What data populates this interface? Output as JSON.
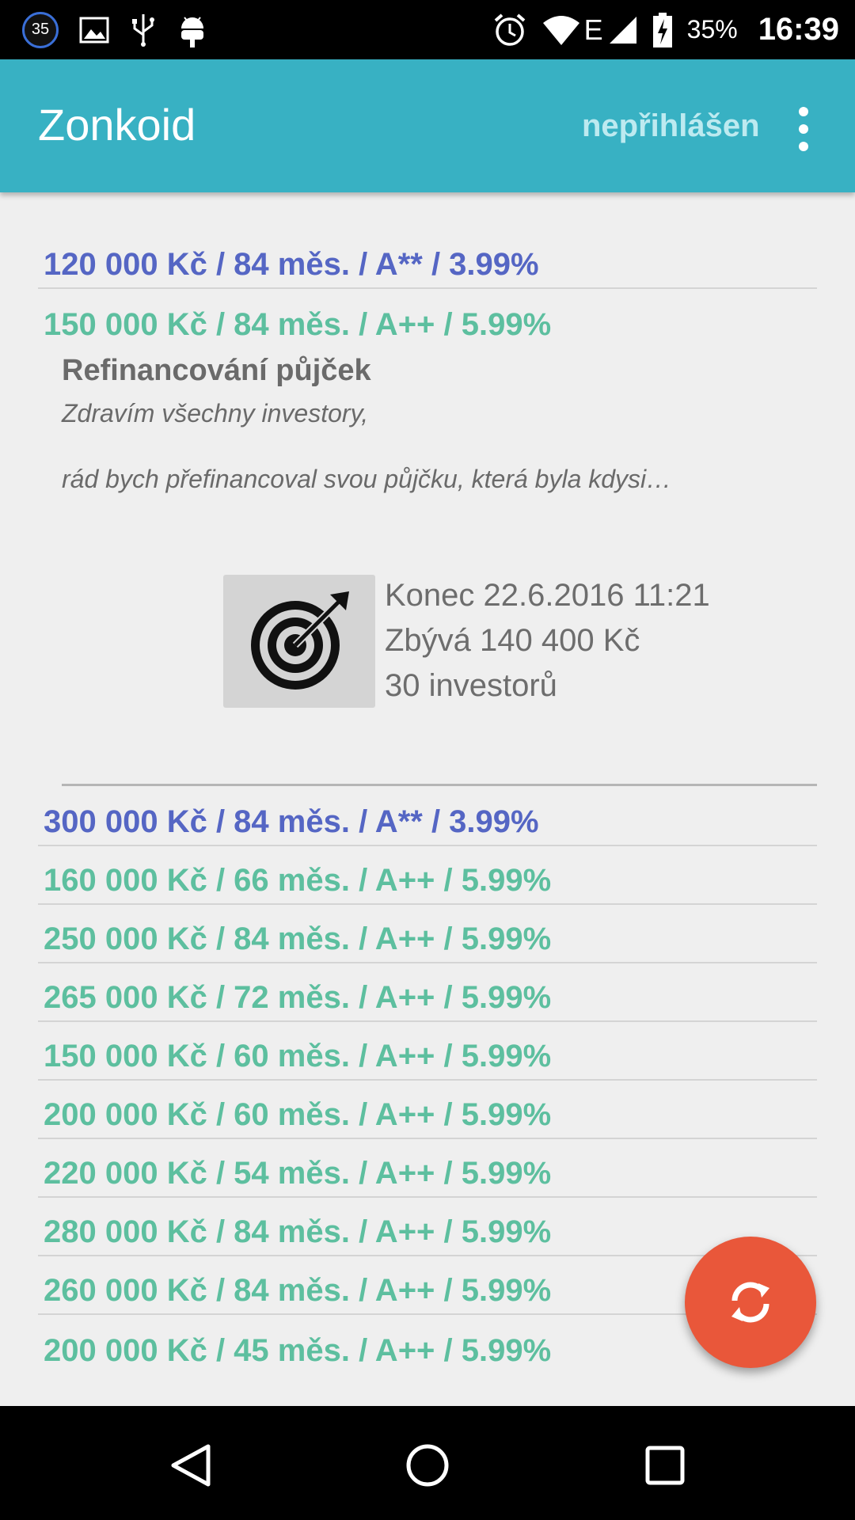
{
  "status_bar": {
    "notification_count": "35",
    "battery": "35%",
    "time": "16:39",
    "network_type": "E"
  },
  "app_bar": {
    "title": "Zonkoid",
    "login_status": "nepřihlášen"
  },
  "loans": [
    {
      "label": "120 000 Kč / 84 měs. / A** / 3.99%",
      "color": "#5566c4"
    },
    {
      "label": "150 000 Kč / 84 měs. / A++ / 5.99%",
      "color": "#5dbf9f"
    },
    {
      "label": "300 000 Kč / 84 měs. / A** / 3.99%",
      "color": "#5566c4"
    },
    {
      "label": "160 000 Kč / 66 měs. / A++ / 5.99%",
      "color": "#5dbf9f"
    },
    {
      "label": "250 000 Kč / 84 měs. / A++ / 5.99%",
      "color": "#5dbf9f"
    },
    {
      "label": "265 000 Kč / 72 měs. / A++ / 5.99%",
      "color": "#5dbf9f"
    },
    {
      "label": "150 000 Kč / 60 měs. / A++ / 5.99%",
      "color": "#5dbf9f"
    },
    {
      "label": "200 000 Kč / 60 měs. / A++ / 5.99%",
      "color": "#5dbf9f"
    },
    {
      "label": "220 000 Kč / 54 měs. / A++ / 5.99%",
      "color": "#5dbf9f"
    },
    {
      "label": "280 000 Kč / 84 měs. / A++ / 5.99%",
      "color": "#5dbf9f"
    },
    {
      "label": "260 000 Kč / 84 měs. / A++ / 5.99%",
      "color": "#5dbf9f"
    },
    {
      "label": "200 000 Kč / 45 měs. / A++ / 5.99%",
      "color": "#5dbf9f"
    }
  ],
  "expanded_loan": {
    "title": "Refinancování půjček",
    "desc_line1": "Zdravím všechny investory,",
    "desc_line2": "rád bych přefinancoval svou půjčku, která byla kdysi…",
    "icon": "target-icon",
    "end": "Konec 22.6.2016 11:21",
    "remaining": "Zbývá 140 400 Kč",
    "investors": "30 investorů"
  },
  "fab": {
    "icon": "refresh-icon",
    "color": "#e9573a"
  },
  "colors": {
    "app_bar": "#38b1c3",
    "rating_aa_star": "#5566c4",
    "rating_aa_plus": "#5dbf9f"
  }
}
